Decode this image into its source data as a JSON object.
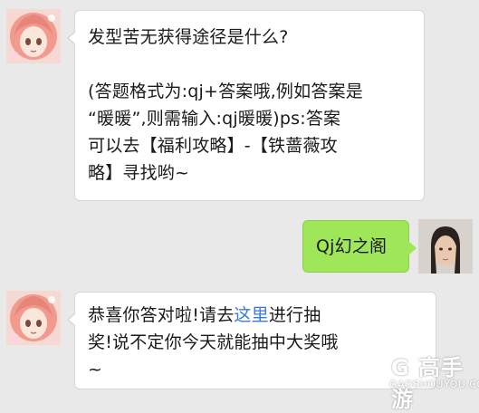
{
  "chat": {
    "messages": [
      {
        "from": "bot",
        "avatar": "anime-girl-avatar",
        "lines": [
          "发型苦无获得途径是什么?",
          "",
          "(答题格式为:qj+答案哦,例如答案是",
          "“暖暖”,则需输入:qj暖暖)ps:答案",
          "可以去【福利攻略】-【铁蔷薇攻",
          "略】寻找哟~"
        ]
      },
      {
        "from": "user",
        "avatar": "user-photo-avatar",
        "text": "Qj幻之阁"
      },
      {
        "from": "bot",
        "avatar": "anime-girl-avatar",
        "line1_pre": "恭喜你答对啦!请去",
        "line1_link": "这里",
        "line1_post": "进行抽",
        "line2": "奖!说不定你今天就能抽中大奖哦",
        "line3": "~"
      }
    ]
  },
  "watermark": {
    "name": "G 高手游",
    "domain": "GAOSHOUYOU.COM",
    "icon": "gaoshouyou-logo-icon"
  },
  "colors": {
    "background": "#e9e9e9",
    "bot_bubble": "#ffffff",
    "user_bubble": "#9fe659",
    "link": "#3a7bd5"
  }
}
